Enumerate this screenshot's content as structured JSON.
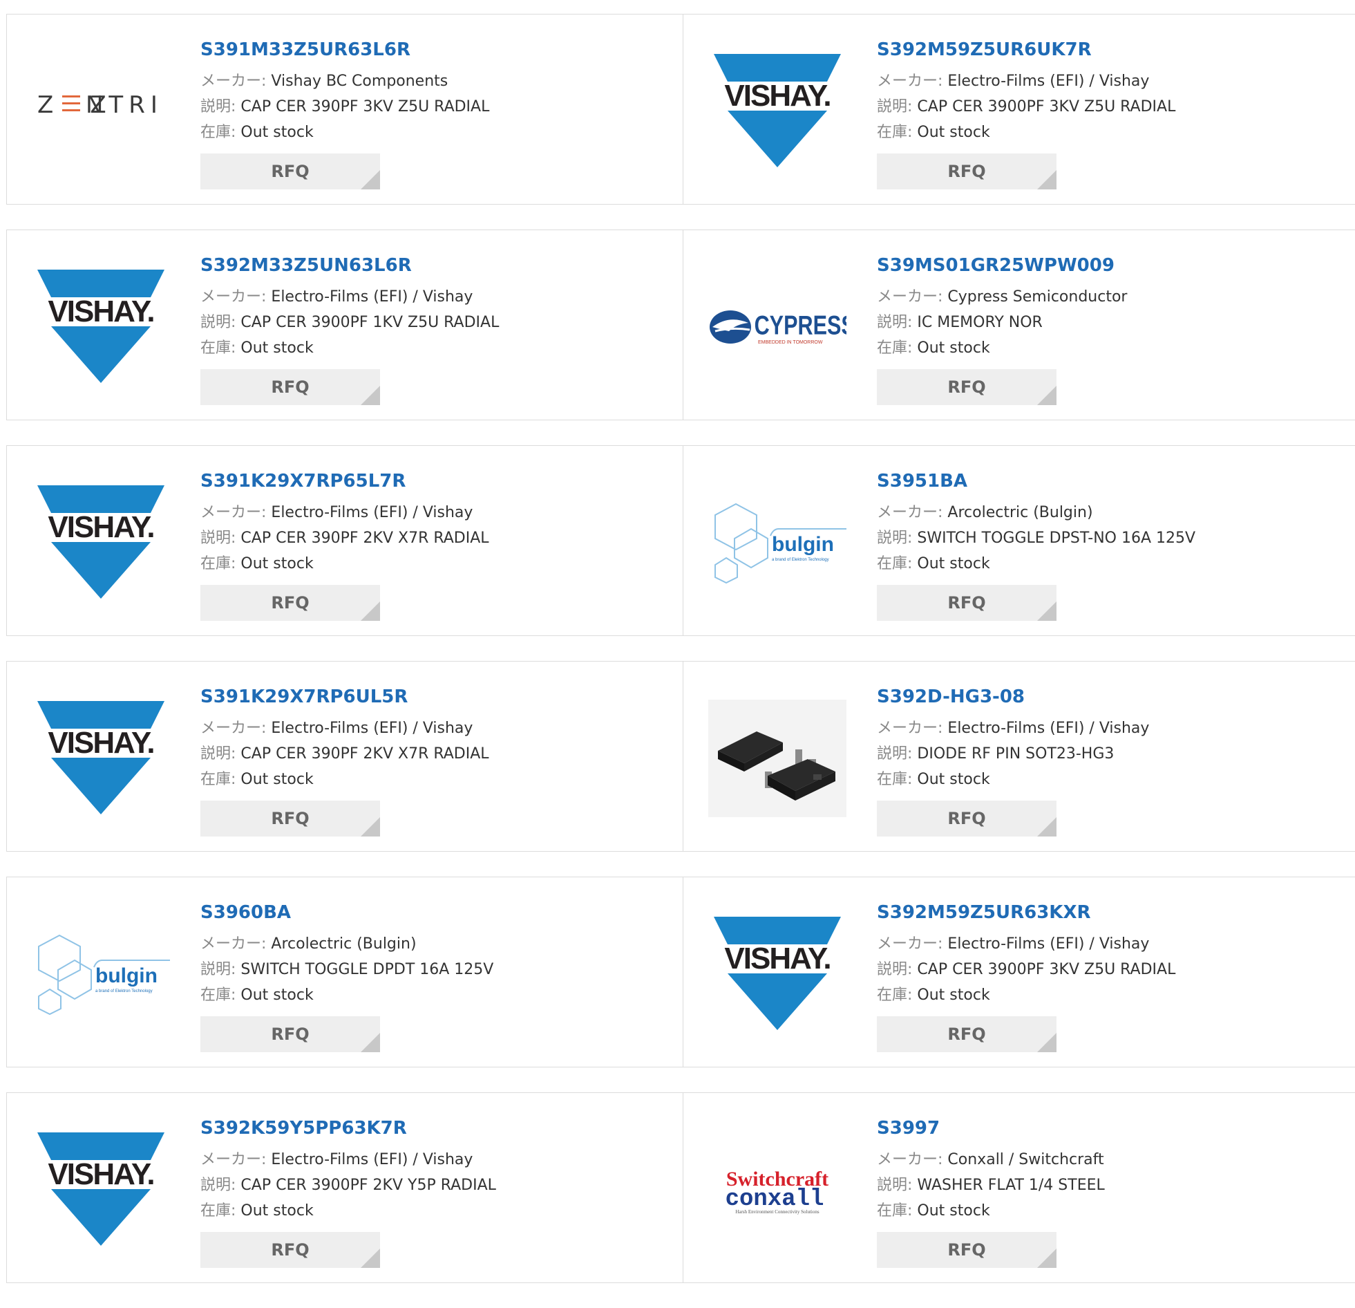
{
  "labels": {
    "maker": "メーカー:",
    "desc": "説明:",
    "stock": "在庫:",
    "rfq": "RFQ"
  },
  "products": [
    {
      "pn": "S391M33Z5UR63L6R",
      "maker": "Vishay BC Components",
      "desc": "CAP CER 390PF 3KV Z5U RADIAL",
      "stock": "Out stock",
      "logo": "zentri-logo"
    },
    {
      "pn": "S392M59Z5UR6UK7R",
      "maker": "Electro-Films (EFI) / Vishay",
      "desc": "CAP CER 3900PF 3KV Z5U RADIAL",
      "stock": "Out stock",
      "logo": "vishay-logo"
    },
    {
      "pn": "S392M33Z5UN63L6R",
      "maker": "Electro-Films (EFI) / Vishay",
      "desc": "CAP CER 3900PF 1KV Z5U RADIAL",
      "stock": "Out stock",
      "logo": "vishay-logo"
    },
    {
      "pn": "S39MS01GR25WPW009",
      "maker": "Cypress Semiconductor",
      "desc": "IC MEMORY NOR",
      "stock": "Out stock",
      "logo": "cypress-logo"
    },
    {
      "pn": "S391K29X7RP65L7R",
      "maker": "Electro-Films (EFI) / Vishay",
      "desc": "CAP CER 390PF 2KV X7R RADIAL",
      "stock": "Out stock",
      "logo": "vishay-logo"
    },
    {
      "pn": "S3951BA",
      "maker": "Arcolectric (Bulgin)",
      "desc": "SWITCH TOGGLE DPST-NO 16A 125V",
      "stock": "Out stock",
      "logo": "bulgin-logo"
    },
    {
      "pn": "S391K29X7RP6UL5R",
      "maker": "Electro-Films (EFI) / Vishay",
      "desc": "CAP CER 390PF 2KV X7R RADIAL",
      "stock": "Out stock",
      "logo": "vishay-logo"
    },
    {
      "pn": "S392D-HG3-08",
      "maker": "Electro-Films (EFI) / Vishay",
      "desc": "DIODE RF PIN SOT23-HG3",
      "stock": "Out stock",
      "logo": "sot23-package-image"
    },
    {
      "pn": "S3960BA",
      "maker": "Arcolectric (Bulgin)",
      "desc": "SWITCH TOGGLE DPDT 16A 125V",
      "stock": "Out stock",
      "logo": "bulgin-logo"
    },
    {
      "pn": "S392M59Z5UR63KXR",
      "maker": "Electro-Films (EFI) / Vishay",
      "desc": "CAP CER 3900PF 3KV Z5U RADIAL",
      "stock": "Out stock",
      "logo": "vishay-logo"
    },
    {
      "pn": "S392K59Y5PP63K7R",
      "maker": "Electro-Films (EFI) / Vishay",
      "desc": "CAP CER 3900PF 2KV Y5P RADIAL",
      "stock": "Out stock",
      "logo": "vishay-logo"
    },
    {
      "pn": "S3997",
      "maker": "Conxall / Switchcraft",
      "desc": "WASHER FLAT 1/4 STEEL",
      "stock": "Out stock",
      "logo": "switchcraft-conxall-logo"
    }
  ],
  "logo_text": {
    "zentri": "Z≡NTRI",
    "vishay": "VISHAY.",
    "cypress": "CYPRESS",
    "cypress_tag": "EMBEDDED IN TOMORROW",
    "bulgin": "bulgin",
    "bulgin_tag": "a brand of Elektron Technology",
    "switchcraft": "Switchcraft",
    "conxall": "conxall",
    "conxall_tag": "Harsh Environment Connectivity Solutions"
  },
  "colors": {
    "link": "#1f6bb5",
    "vishay_blue": "#1b86c8",
    "label": "#888888",
    "rfq_bg": "#eeeeee"
  }
}
